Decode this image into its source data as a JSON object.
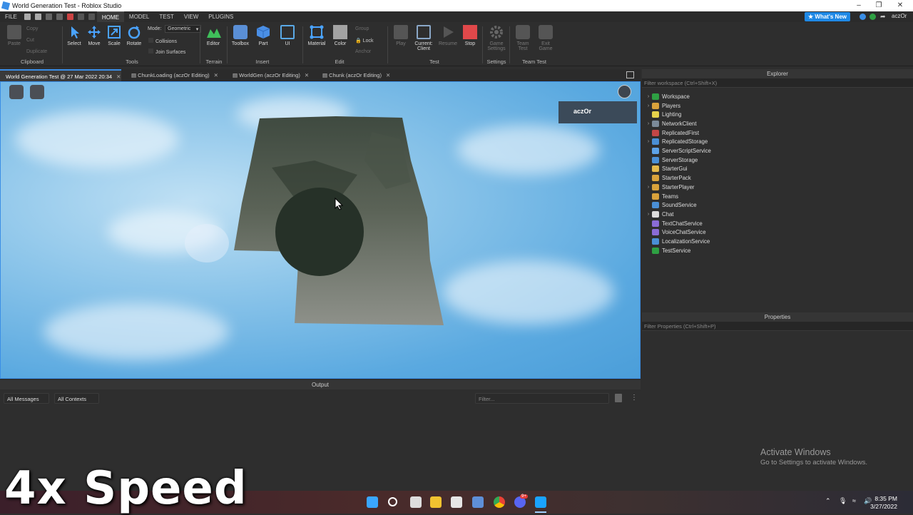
{
  "window": {
    "title": "World Generation Test - Roblox Studio"
  },
  "menu": {
    "items": [
      "FILE",
      "HOME",
      "MODEL",
      "TEST",
      "VIEW",
      "PLUGINS"
    ],
    "active": "HOME",
    "whats_new": "What's New",
    "user": "aczOr"
  },
  "ribbon": {
    "clipboard": {
      "paste": "Paste",
      "copy": "Copy",
      "cut": "Cut",
      "duplicate": "Duplicate",
      "label": "Clipboard"
    },
    "tools": {
      "select": "Select",
      "move": "Move",
      "scale": "Scale",
      "rotate": "Rotate",
      "label": "Tools"
    },
    "mode": {
      "label": "Mode:",
      "value": "Geometric",
      "collisions": "Collisions",
      "join_surfaces": "Join Surfaces"
    },
    "terrain": {
      "editor": "Editor",
      "label": "Terrain"
    },
    "insert": {
      "toolbox": "Toolbox",
      "part": "Part",
      "ui": "UI",
      "label": "Insert"
    },
    "edit": {
      "material": "Material",
      "color": "Color",
      "group": "Group",
      "lock": "Lock",
      "anchor": "Anchor",
      "label": "Edit"
    },
    "test": {
      "play": "Play",
      "current_client": "Current:\nClient",
      "resume": "Resume",
      "stop": "Stop",
      "label": "Test"
    },
    "settings": {
      "game_settings": "Game\nSettings",
      "label": "Settings"
    },
    "team_test": {
      "team_test": "Team\nTest",
      "exit_game": "Exit\nGame",
      "label": "Team Test"
    }
  },
  "tabs": [
    {
      "label": "World Generation Test @ 27 Mar 2022 20:34",
      "active": true
    },
    {
      "label": "ChunkLoading (aczOr Editing)",
      "active": false
    },
    {
      "label": "WorldGen (aczOr Editing)",
      "active": false
    },
    {
      "label": "Chunk (aczOr Editing)",
      "active": false
    }
  ],
  "viewport": {
    "player_name": "aczOr"
  },
  "explorer": {
    "title": "Explorer",
    "filter_placeholder": "Filter workspace (Ctrl+Shift+X)",
    "items": [
      {
        "label": "Workspace",
        "expandable": true,
        "color": "#2ea043"
      },
      {
        "label": "Players",
        "expandable": true,
        "color": "#d9a23b"
      },
      {
        "label": "Lighting",
        "expandable": false,
        "color": "#e6d24a"
      },
      {
        "label": "NetworkClient",
        "expandable": true,
        "color": "#7c8a99"
      },
      {
        "label": "ReplicatedFirst",
        "expandable": false,
        "color": "#c24646"
      },
      {
        "label": "ReplicatedStorage",
        "expandable": true,
        "color": "#4a8fd6"
      },
      {
        "label": "ServerScriptService",
        "expandable": false,
        "color": "#5da2e8"
      },
      {
        "label": "ServerStorage",
        "expandable": false,
        "color": "#4a8fd6"
      },
      {
        "label": "StarterGui",
        "expandable": false,
        "color": "#e5b94a"
      },
      {
        "label": "StarterPack",
        "expandable": false,
        "color": "#d9a23b"
      },
      {
        "label": "StarterPlayer",
        "expandable": true,
        "color": "#d9a23b"
      },
      {
        "label": "Teams",
        "expandable": false,
        "color": "#d9a23b"
      },
      {
        "label": "SoundService",
        "expandable": false,
        "color": "#4a8fd6"
      },
      {
        "label": "Chat",
        "expandable": true,
        "color": "#dcdcdc"
      },
      {
        "label": "TextChatService",
        "expandable": false,
        "color": "#8a6bd6"
      },
      {
        "label": "VoiceChatService",
        "expandable": false,
        "color": "#8a6bd6"
      },
      {
        "label": "LocalizationService",
        "expandable": false,
        "color": "#4a8fd6"
      },
      {
        "label": "TestService",
        "expandable": false,
        "color": "#2ea043"
      }
    ]
  },
  "properties": {
    "title": "Properties",
    "filter_placeholder": "Filter Properties (Ctrl+Shift+P)"
  },
  "output": {
    "title": "Output",
    "messages_filter": "All Messages",
    "contexts_filter": "All Contexts",
    "filter_placeholder": "Filter..."
  },
  "watermark": {
    "line1": "Activate Windows",
    "line2": "Go to Settings to activate Windows."
  },
  "overlay": {
    "speed": "4x Speed"
  },
  "taskbar": {
    "time": "8:35 PM",
    "date": "3/27/2022",
    "discord_badge": "9+"
  }
}
